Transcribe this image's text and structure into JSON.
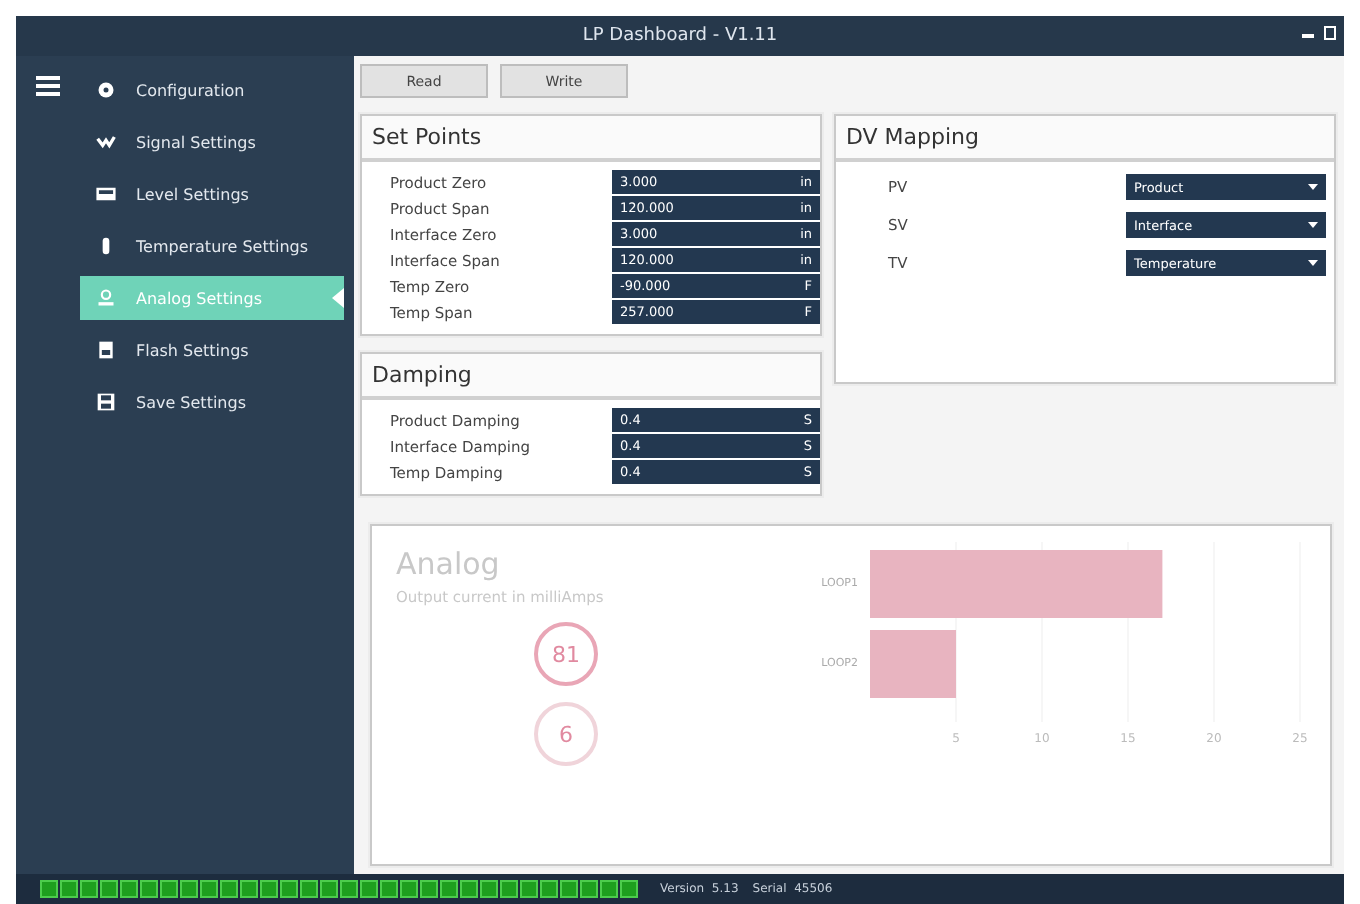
{
  "window": {
    "title": "LP Dashboard - V1.11"
  },
  "sidebar": {
    "items": [
      {
        "label": "Configuration",
        "selected": false
      },
      {
        "label": "Signal Settings",
        "selected": false
      },
      {
        "label": "Level Settings",
        "selected": false
      },
      {
        "label": "Temperature Settings",
        "selected": false
      },
      {
        "label": "Analog Settings",
        "selected": true
      },
      {
        "label": "Flash Settings",
        "selected": false
      },
      {
        "label": "Save Settings",
        "selected": false
      }
    ]
  },
  "toolbar": {
    "buttons": [
      "Read",
      "Write"
    ]
  },
  "set_points": {
    "title": "Set Points",
    "rows": [
      {
        "label": "Product Zero",
        "value": "3.000",
        "unit": "in"
      },
      {
        "label": "Product Span",
        "value": "120.000",
        "unit": "in"
      },
      {
        "label": "Interface Zero",
        "value": "3.000",
        "unit": "in"
      },
      {
        "label": "Interface Span",
        "value": "120.000",
        "unit": "in"
      },
      {
        "label": "Temp Zero",
        "value": "-90.000",
        "unit": "F"
      },
      {
        "label": "Temp Span",
        "value": "257.000",
        "unit": "F"
      }
    ]
  },
  "damping": {
    "title": "Damping",
    "rows": [
      {
        "label": "Product Damping",
        "value": "0.4",
        "unit": "S"
      },
      {
        "label": "Interface Damping",
        "value": "0.4",
        "unit": "S"
      },
      {
        "label": "Temp Damping",
        "value": "0.4",
        "unit": "S"
      }
    ]
  },
  "dv_mapping": {
    "title": "DV Mapping",
    "rows": [
      {
        "label": "PV",
        "value": "Product"
      },
      {
        "label": "SV",
        "value": "Interface"
      },
      {
        "label": "TV",
        "value": "Temperature"
      }
    ]
  },
  "analog": {
    "title": "Analog",
    "subtitle": "Output current in milliAmps",
    "gauges": [
      "81",
      "6"
    ],
    "chart_data": {
      "type": "bar",
      "orientation": "horizontal",
      "categories": [
        "LOOP1",
        "LOOP2"
      ],
      "series": [
        {
          "color": "#e8b4c0",
          "values": [
            17,
            5
          ]
        }
      ],
      "xlim": [
        0,
        25
      ],
      "xticks": [
        5,
        10,
        15,
        20,
        25
      ],
      "grid": true
    }
  },
  "status_bar": {
    "version_label": "Version",
    "version": "5.13",
    "serial_label": "Serial",
    "serial": "45506"
  }
}
